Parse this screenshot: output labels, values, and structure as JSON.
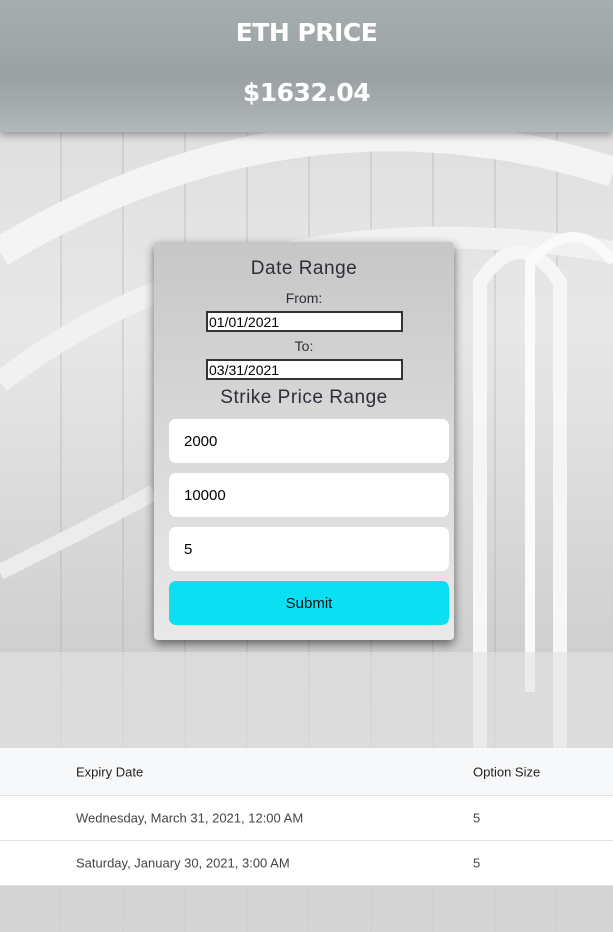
{
  "header": {
    "title": "ETH PRICE",
    "price": "$1632.04"
  },
  "form": {
    "date_range_heading": "Date Range",
    "from_label": "From:",
    "from_value": "01/01/2021",
    "to_label": "To:",
    "to_value": "03/31/2021",
    "strike_heading": "Strike Price Range",
    "strike_min": "2000",
    "strike_max": "10000",
    "option_size": "5",
    "submit_label": "Submit",
    "submit_color": "#0ae0f2"
  },
  "table": {
    "headers": [
      "Expiry Date",
      "Option Size"
    ],
    "rows": [
      [
        "Wednesday,  March 31, 2021, 12:00 AM",
        "5"
      ],
      [
        "Saturday, January 30, 2021, 3:00 AM",
        "5"
      ]
    ]
  }
}
